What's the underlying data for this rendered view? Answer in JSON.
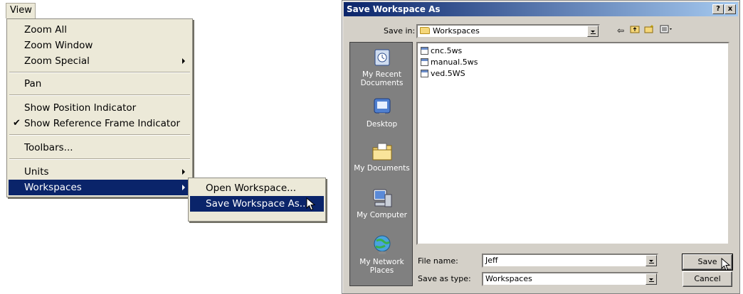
{
  "menubar": {
    "view": "View"
  },
  "view_menu": {
    "zoom_all": "Zoom All",
    "zoom_window": "Zoom Window",
    "zoom_special": "Zoom Special",
    "pan": "Pan",
    "show_position_indicator": "Show Position Indicator",
    "show_reference_frame_indicator": "Show Reference Frame Indicator",
    "reference_frame_checked": "✔",
    "toolbars": "Toolbars...",
    "units": "Units",
    "workspaces": "Workspaces"
  },
  "workspaces_menu": {
    "open": "Open Workspace...",
    "save_as": "Save Workspace As..."
  },
  "dialog": {
    "title": "Save Workspace As",
    "help_btn": "?",
    "close_btn": "x",
    "save_in_label": "Save in:",
    "save_in_value": "Workspaces",
    "places": [
      {
        "label": "My Recent Documents",
        "icon": "recent-documents-icon"
      },
      {
        "label": "Desktop",
        "icon": "desktop-icon"
      },
      {
        "label": "My Documents",
        "icon": "my-documents-icon"
      },
      {
        "label": "My Computer",
        "icon": "my-computer-icon"
      },
      {
        "label": "My Network Places",
        "icon": "network-places-icon"
      }
    ],
    "files": [
      "cnc.5ws",
      "manual.5ws",
      "ved.5WS"
    ],
    "file_name_label": "File name:",
    "file_name_value": "Jeff",
    "save_as_type_label": "Save as type:",
    "save_as_type_value": "Workspaces",
    "save_button": "Save",
    "cancel_button": "Cancel"
  },
  "colors": {
    "menu_bg": "#ece9d8",
    "selection": "#0a246a",
    "dialog_bg": "#d4d0c8",
    "places_bg": "#808080"
  }
}
